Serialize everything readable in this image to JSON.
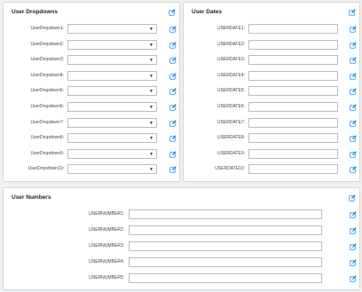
{
  "colors": {
    "accent": "#1e88e5",
    "panel_bg": "#ffffff",
    "page_bg": "#eef0f2",
    "border": "#d4d8dc"
  },
  "dropdowns_panel": {
    "title": "User Dropdowns",
    "edit_icon": "pencil-square-icon",
    "items": [
      {
        "label": "UserDropdown1:",
        "value": ""
      },
      {
        "label": "UserDropdown2:",
        "value": ""
      },
      {
        "label": "UserDropdown3:",
        "value": ""
      },
      {
        "label": "UserDropdown4:",
        "value": ""
      },
      {
        "label": "UserDropdown5:",
        "value": ""
      },
      {
        "label": "UserDropdown6:",
        "value": ""
      },
      {
        "label": "UserDropdown7:",
        "value": ""
      },
      {
        "label": "UserDropdown8:",
        "value": ""
      },
      {
        "label": "UserDropdown9:",
        "value": ""
      },
      {
        "label": "UserDropdown10:",
        "value": ""
      }
    ]
  },
  "dates_panel": {
    "title": "User Dates",
    "edit_icon": "pencil-square-icon",
    "items": [
      {
        "label": "USERDATE1:",
        "value": ""
      },
      {
        "label": "USERDATE2:",
        "value": ""
      },
      {
        "label": "USERDATE3:",
        "value": ""
      },
      {
        "label": "USERDATE4:",
        "value": ""
      },
      {
        "label": "USERDATE5:",
        "value": ""
      },
      {
        "label": "USERDATE6:",
        "value": ""
      },
      {
        "label": "USERDATE7:",
        "value": ""
      },
      {
        "label": "USERDATE8:",
        "value": ""
      },
      {
        "label": "USERDATE9:",
        "value": ""
      },
      {
        "label": "USERDATE10:",
        "value": ""
      }
    ]
  },
  "numbers_panel": {
    "title": "User Numbers",
    "edit_icon": "pencil-square-icon",
    "items": [
      {
        "label": "USERNUMBER1:",
        "value": ""
      },
      {
        "label": "USERNUMBER2:",
        "value": ""
      },
      {
        "label": "USERNUMBER3:",
        "value": ""
      },
      {
        "label": "USERNUMBER4:",
        "value": ""
      },
      {
        "label": "USERNUMBER5:",
        "value": ""
      }
    ]
  }
}
